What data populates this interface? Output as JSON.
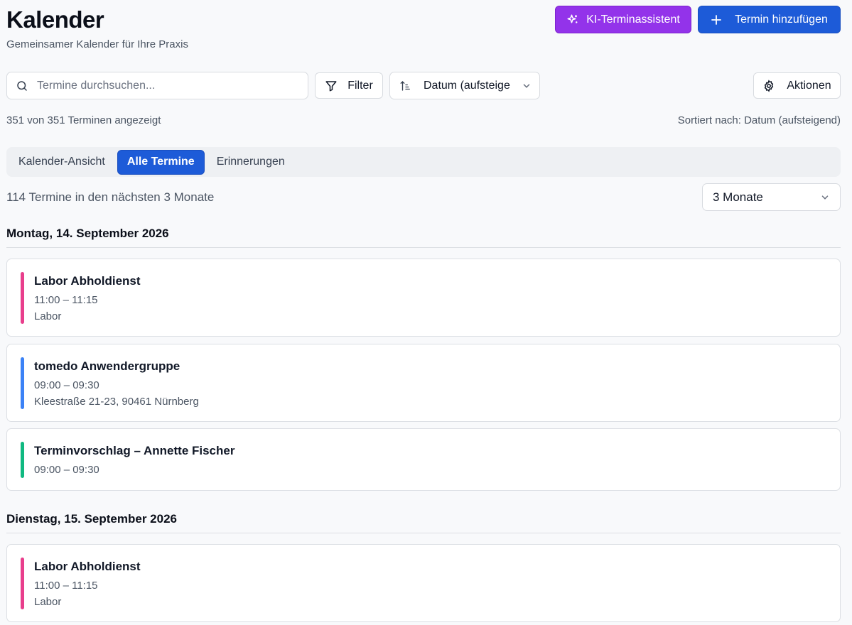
{
  "header": {
    "title": "Kalender",
    "subtitle": "Gemeinsamer Kalender für Ihre Praxis",
    "ai_button": "KI-Terminassistent",
    "add_button": "Termin hinzufügen"
  },
  "toolbar": {
    "search_placeholder": "Termine durchsuchen...",
    "filter_label": "Filter",
    "sort_value": "Datum (aufsteigend)",
    "actions_label": "Aktionen"
  },
  "status": {
    "count_text": "351 von 351 Terminen angezeigt",
    "sort_text": "Sortiert nach: Datum (aufsteigend)"
  },
  "tabs": [
    {
      "label": "Kalender-Ansicht",
      "active": false
    },
    {
      "label": "Alle Termine",
      "active": true
    },
    {
      "label": "Erinnerungen",
      "active": false
    }
  ],
  "list": {
    "upcoming_text": "114 Termine in den nächsten 3 Monate",
    "range_value": "3 Monate"
  },
  "days": [
    {
      "date": "Montag, 14. September 2026",
      "events": [
        {
          "title": "Labor Abholdienst",
          "time": "11:00 – 11:15",
          "location": "Labor",
          "color": "#e83e8c"
        },
        {
          "title": "tomedo Anwendergruppe",
          "time": "09:00 – 09:30",
          "location": "Kleestraße 21-23, 90461 Nürnberg",
          "color": "#3b82f6"
        },
        {
          "title": "Terminvorschlag – Annette Fischer",
          "time": "09:00 – 09:30",
          "location": "",
          "color": "#10b981"
        }
      ]
    },
    {
      "date": "Dienstag, 15. September 2026",
      "events": [
        {
          "title": "Labor Abholdienst",
          "time": "11:00 – 11:15",
          "location": "Labor",
          "color": "#e83e8c"
        }
      ]
    }
  ],
  "icons": {
    "ai": "sparkles-icon",
    "add": "plus-icon",
    "search": "search-icon",
    "filter": "filter-icon",
    "sort": "sort-ascending-icon",
    "actions": "gear-icon",
    "dropdown": "chevron-down-icon"
  },
  "colors": {
    "primary": "#1d5bd8",
    "ai_accent": "#9333ea"
  }
}
